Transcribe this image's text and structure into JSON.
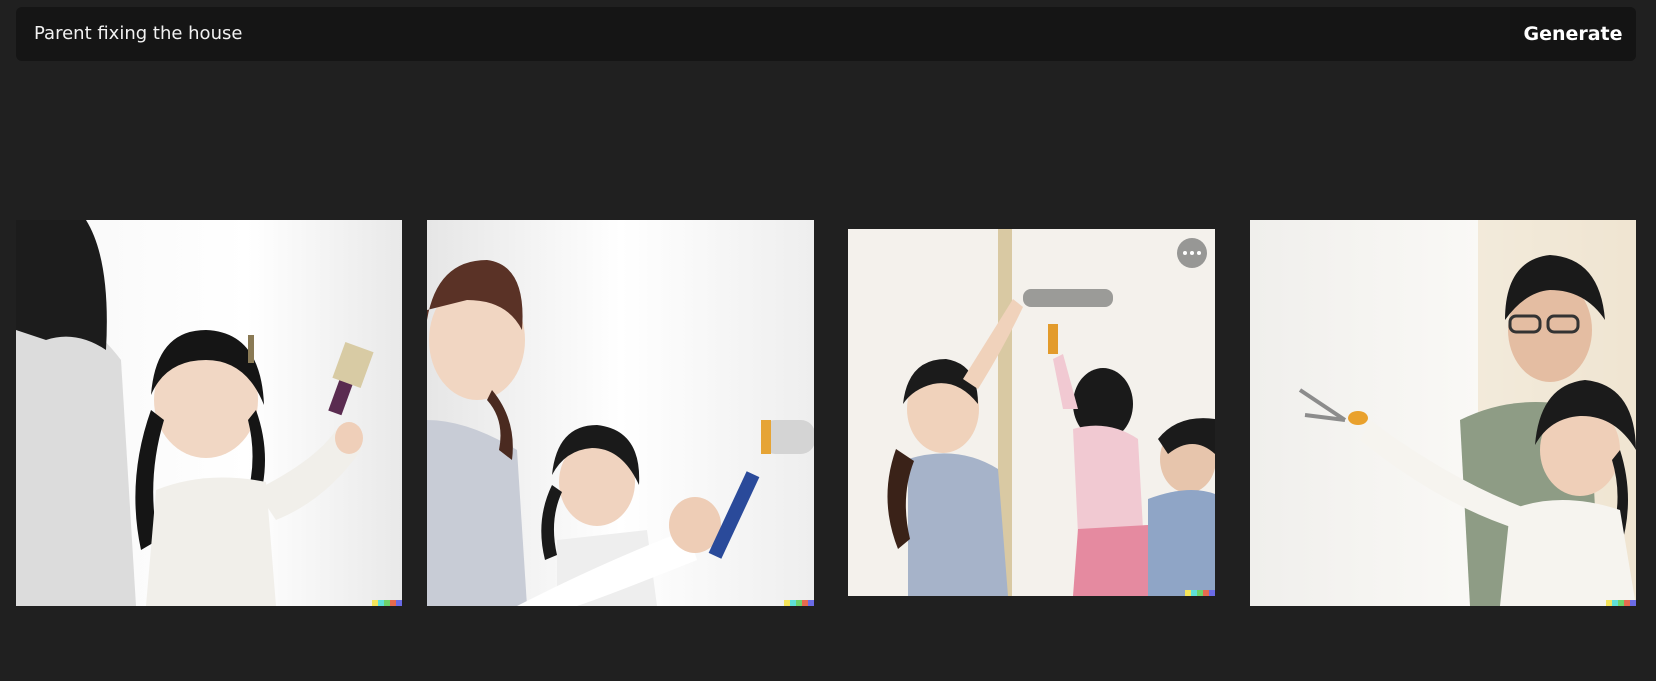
{
  "prompt": {
    "value": "Parent fixing the house"
  },
  "toolbar": {
    "generate_label": "Generate"
  },
  "watermark_colors": [
    "#f5e55a",
    "#5ee0d8",
    "#6fd36a",
    "#e66a4e",
    "#6b6be6"
  ],
  "results": [
    {
      "tool": "paintbrush-icon"
    },
    {
      "tool": "paint-roller-icon"
    },
    {
      "tool": "paint-roller-icon",
      "menu_icon": "more-options-icon"
    },
    {
      "tool": "scissors-icon"
    }
  ]
}
